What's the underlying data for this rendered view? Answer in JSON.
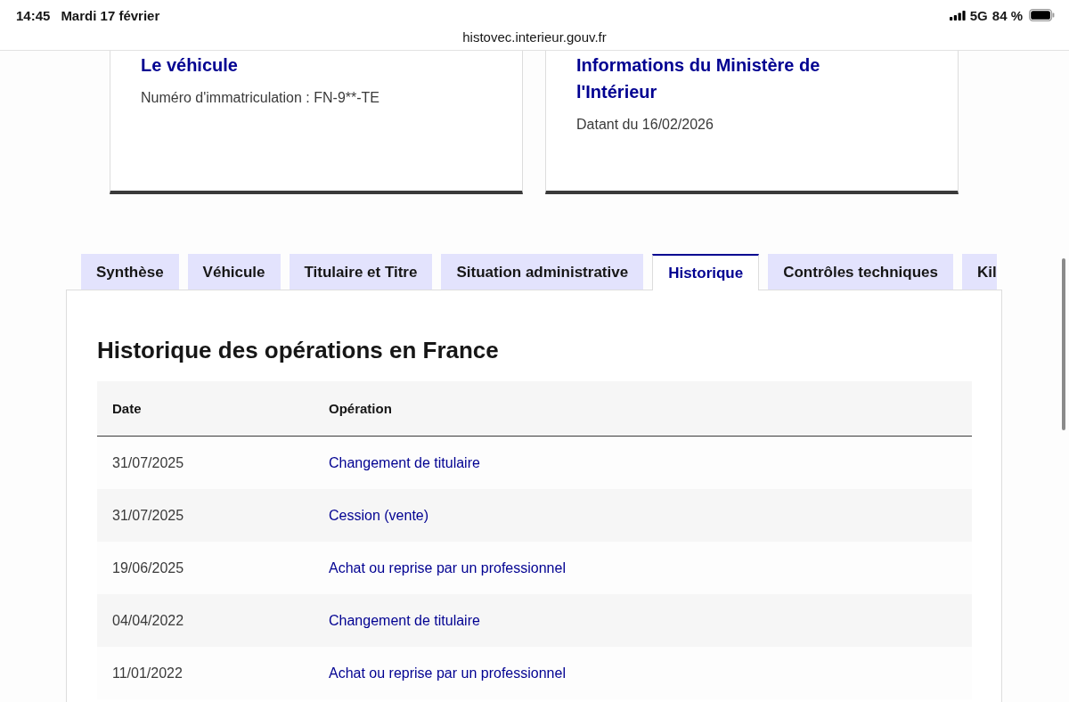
{
  "status_bar": {
    "time": "14:45",
    "date": "Mardi 17 février",
    "network": "5G",
    "battery": "84 %"
  },
  "address_bar": {
    "url": "histovec.interieur.gouv.fr"
  },
  "cards": [
    {
      "title": "Le véhicule",
      "text": "Numéro d'immatriculation : FN-9**-TE"
    },
    {
      "title": "Informations du Ministère de l'Intérieur",
      "text": "Datant du 16/02/2026"
    }
  ],
  "tabs": [
    {
      "label": "Synthèse",
      "selected": false
    },
    {
      "label": "Véhicule",
      "selected": false
    },
    {
      "label": "Titulaire et Titre",
      "selected": false
    },
    {
      "label": "Situation administrative",
      "selected": false
    },
    {
      "label": "Historique",
      "selected": true
    },
    {
      "label": "Contrôles techniques",
      "selected": false
    },
    {
      "label": "Kil",
      "selected": false
    }
  ],
  "panel": {
    "heading": "Historique des opérations en France",
    "table": {
      "columns": [
        "Date",
        "Opération"
      ],
      "rows": [
        {
          "date": "31/07/2025",
          "operation": "Changement de titulaire"
        },
        {
          "date": "31/07/2025",
          "operation": "Cession (vente)"
        },
        {
          "date": "19/06/2025",
          "operation": "Achat ou reprise par un professionnel"
        },
        {
          "date": "04/04/2022",
          "operation": "Changement de titulaire"
        },
        {
          "date": "11/01/2022",
          "operation": "Achat ou reprise par un professionnel"
        }
      ]
    }
  }
}
